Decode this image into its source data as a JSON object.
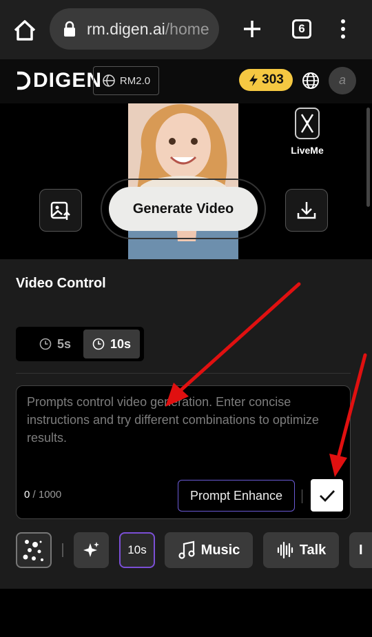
{
  "browser": {
    "url_host": "rm.digen.ai",
    "url_path": "/home",
    "tab_count": "6"
  },
  "header": {
    "logo_text": "DIGEN",
    "version_label": "RM2.0",
    "credits": "303",
    "avatar_initial": "a"
  },
  "preview": {
    "liveme_label": "LiveMe",
    "generate_label": "Generate Video"
  },
  "panel": {
    "title": "Video Control",
    "durations": [
      "5s",
      "10s"
    ],
    "selected_duration": "10s",
    "prompt_placeholder": "Prompts control video generation. Enter concise instructions and try different combinations to optimize results.",
    "char_current": "0",
    "char_max": "/ 1000",
    "enhance_label": "Prompt Enhance"
  },
  "toolbar": {
    "duration_chip": "10s",
    "music_label": "Music",
    "talk_label": "Talk",
    "more_label": "I"
  },
  "colors": {
    "accent_purple": "#7b4fd6",
    "credits_yellow": "#f5c842",
    "annotation_red": "#e01010"
  }
}
